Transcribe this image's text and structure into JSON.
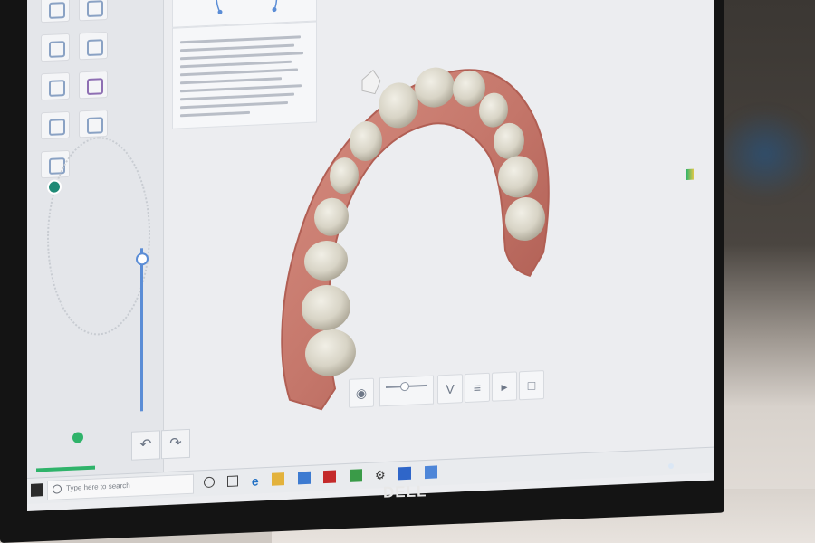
{
  "scene": {
    "description_colors": {
      "screen": "#ecedf0",
      "bezel": "#141414",
      "gum": "#c97b6e",
      "tooth": "#d9d6c9",
      "accent_blue": "#5b8dd6",
      "accent_green": "#2fb36a"
    }
  },
  "monitor": {
    "brand": "DELL"
  },
  "taskbar": {
    "search_placeholder": "Type here to search",
    "icons": [
      "start-icon",
      "search-icon",
      "task-view-icon",
      "edge-icon",
      "file-explorer-icon",
      "store-icon",
      "app-red-icon",
      "app-green-icon",
      "settings-icon",
      "app-blue-icon",
      "app-blue2-icon"
    ]
  },
  "toolbar": {
    "buttons": [
      "tooth-view-button",
      "view-slider",
      "jaw-button",
      "filter-button",
      "play-button",
      "copy-button",
      "paste-button"
    ]
  }
}
